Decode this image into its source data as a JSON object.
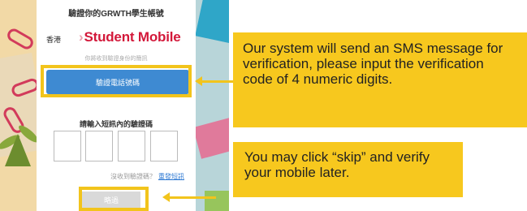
{
  "phone": {
    "title": "驗證你的GRWTH學生帳號",
    "region": "香港",
    "brand": "Student Mobile",
    "hint": "你將收到驗證身份的簡訊",
    "verify_button": "驗證電話號碼",
    "code_label": "請輸入短訊內的驗證碼",
    "code_digits": [
      "",
      "",
      "",
      ""
    ],
    "resend_prompt": "沒收到驗證碼？",
    "resend_link": "重發短訊",
    "skip_button": "略過"
  },
  "callouts": {
    "verify_note": "Our system will send an SMS message for verification, please input the verification code of 4 numeric digits.",
    "skip_note": "You may click “skip” and verify your mobile later."
  },
  "colors": {
    "highlight": "#f2c41c",
    "callout_bg": "#f7c81e",
    "brand_red": "#d3183a",
    "button_blue": "#3e8ad2",
    "link_blue": "#2f7ad3",
    "skip_grey": "#d9d9d9"
  }
}
